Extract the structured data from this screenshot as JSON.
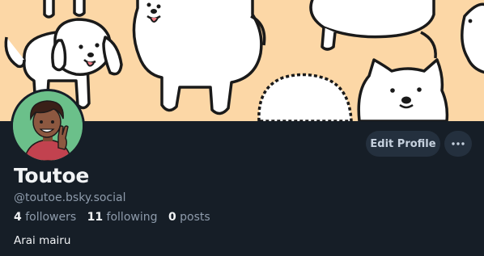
{
  "profile": {
    "display_name": "Toutoe",
    "handle": "@toutoe.bsky.social",
    "bio": "Arai mairu",
    "stats": {
      "followers_count": "4",
      "followers_label": "followers",
      "following_count": "11",
      "following_label": "following",
      "posts_count": "0",
      "posts_label": "posts"
    }
  },
  "actions": {
    "edit_profile_label": "Edit Profile",
    "more_icon": "ellipsis-icon"
  },
  "banner": {
    "description_icon": "dogs-pattern",
    "background_color": "#fcd7a6"
  },
  "avatar": {
    "background_color": "#6bc08a"
  },
  "theme": {
    "page_background": "#161e27",
    "button_background": "#24303e",
    "text_primary": "#f1f3f5",
    "text_secondary": "#8e9bab"
  }
}
